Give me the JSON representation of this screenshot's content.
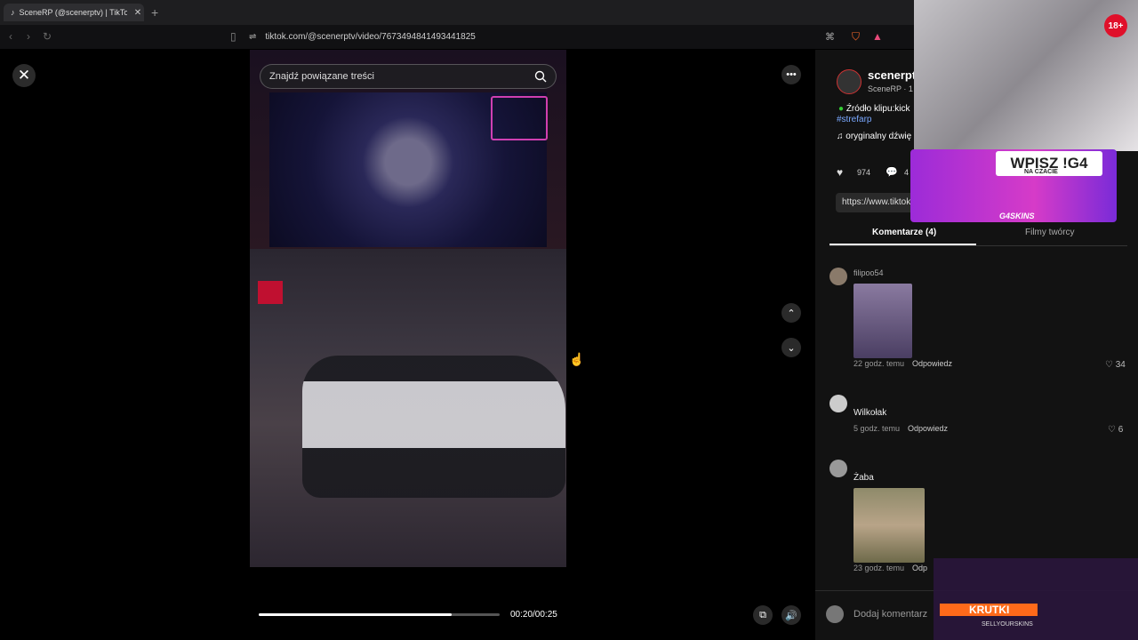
{
  "browser": {
    "tab_title": "SceneRP (@scenerptv) | TikTo",
    "url": "tiktok.com/@scenerptv/video/7673494841493441825"
  },
  "video": {
    "search_placeholder": "Znajdź powiązane treści",
    "time_display": "00:20/00:25",
    "progress": 0.8
  },
  "author": {
    "name": "scenerpt",
    "subtitle": "SceneRP · 1",
    "description": "Źródło klipu:kick",
    "hashtag": "#strefarp",
    "sound": "oryginalny dźwię",
    "likes": "974",
    "comments_short": "4",
    "link": "https://www.tiktok.c"
  },
  "tabs": {
    "comments": "Komentarze (4)",
    "creator_videos": "Filmy twórcy"
  },
  "comments": [
    {
      "user": "filipoo54",
      "time": "22 godz. temu",
      "reply": "Odpowiedz",
      "likes": "34"
    },
    {
      "user": "Wilkołak",
      "time": "5 godz. temu",
      "reply": "Odpowiedz",
      "likes": "6"
    },
    {
      "user": "Żaba",
      "time": "23 godz. temu",
      "reply": "Odp"
    }
  ],
  "add_comment_placeholder": "Dodaj komentarz",
  "overlay": {
    "age_badge": "18+",
    "banner_title": "WPISZ !G4",
    "banner_sub": "NA CZACIE",
    "banner_brand": "G4SKINS",
    "krutki": "KRUTKI",
    "krutki_sub": "SELLYOURSKINS"
  }
}
